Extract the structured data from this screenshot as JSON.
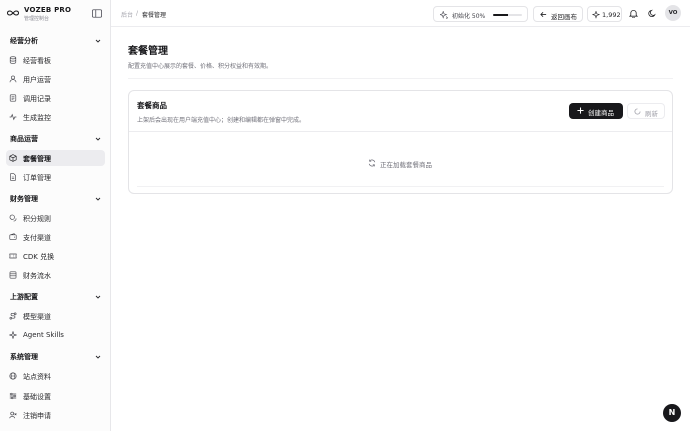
{
  "brand": {
    "name": "VOZEB PRO",
    "subtitle": "管理控制台"
  },
  "sidebar": {
    "sections": [
      {
        "title": "经营分析",
        "items": [
          {
            "label": "经营看板",
            "icon": "database-icon"
          },
          {
            "label": "用户运营",
            "icon": "user-icon"
          },
          {
            "label": "调用记录",
            "icon": "list-icon"
          },
          {
            "label": "生成监控",
            "icon": "activity-icon"
          }
        ]
      },
      {
        "title": "商品运营",
        "items": [
          {
            "label": "套餐管理",
            "icon": "package-icon",
            "active": true
          },
          {
            "label": "订单管理",
            "icon": "file-icon"
          }
        ]
      },
      {
        "title": "财务管理",
        "items": [
          {
            "label": "积分规则",
            "icon": "coins-icon"
          },
          {
            "label": "支付渠道",
            "icon": "wallet-icon"
          },
          {
            "label": "CDK 兑换",
            "icon": "ticket-icon"
          },
          {
            "label": "财务流水",
            "icon": "receipt-icon"
          }
        ]
      },
      {
        "title": "上游配置",
        "items": [
          {
            "label": "模型渠道",
            "icon": "route-icon"
          },
          {
            "label": "Agent Skills",
            "icon": "sparkle-icon"
          }
        ]
      },
      {
        "title": "系统管理",
        "items": [
          {
            "label": "站点资料",
            "icon": "globe-icon"
          },
          {
            "label": "基础设置",
            "icon": "sliders-icon"
          },
          {
            "label": "注销申请",
            "icon": "user-x-icon"
          }
        ]
      }
    ]
  },
  "header": {
    "breadcrumb_root": "后台",
    "breadcrumb_sep": "/",
    "breadcrumb_current": "套餐管理",
    "init_label": "初始化 50%",
    "init_progress": 0.5,
    "back_label": "返回画布",
    "credits": "1,992",
    "avatar_initials": "VO"
  },
  "main": {
    "title": "套餐管理",
    "description": "配置充值中心展示的套餐、价格、积分权益和有效期。",
    "card": {
      "title": "套餐商品",
      "description": "上架后会出现在用户端充值中心；创建和编辑都在弹窗中完成。",
      "create_label": "创建商品",
      "refresh_label": "刷新",
      "loading_text": "正在加载套餐商品"
    }
  },
  "fab": {
    "label": "N"
  }
}
